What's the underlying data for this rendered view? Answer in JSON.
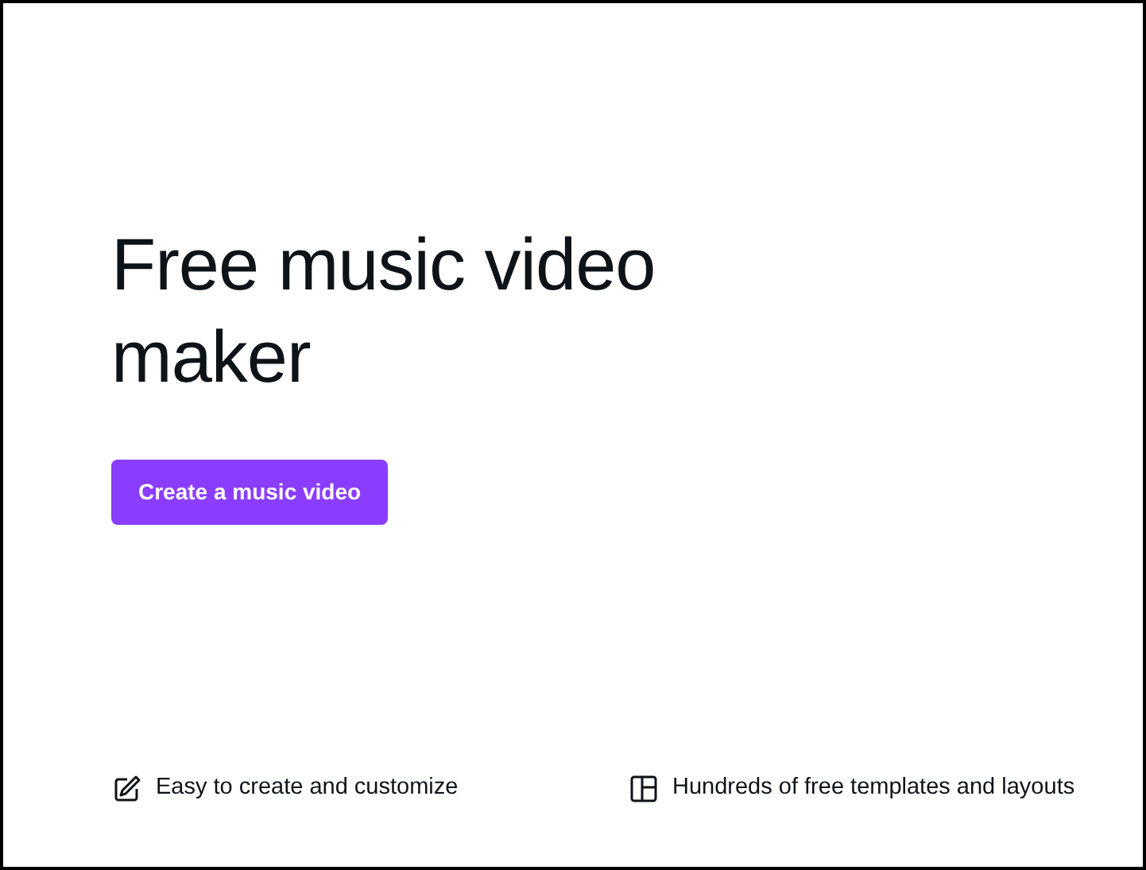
{
  "hero": {
    "title": "Free music video maker",
    "button": "Create a music video"
  },
  "features": [
    {
      "kind": "edit",
      "text": "Easy to create and customize"
    },
    {
      "kind": "layout",
      "text": "Hundreds of free templates and layouts"
    }
  ]
}
